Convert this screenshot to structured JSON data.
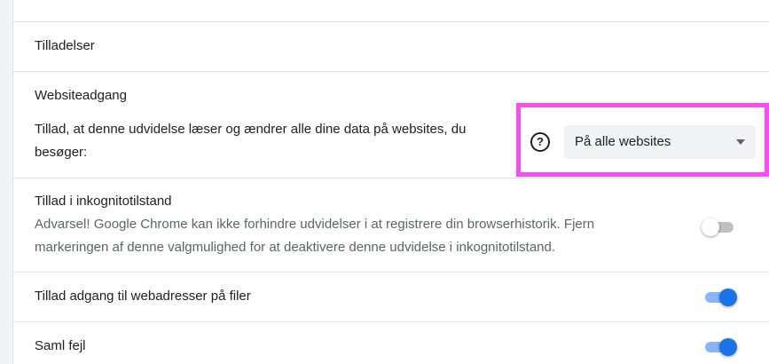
{
  "permissions": {
    "heading": "Tilladelser"
  },
  "site_access": {
    "heading": "Websiteadgang",
    "description_line1": "Tillad, at denne udvidelse læser og ændrer alle dine data på websites, du",
    "description_line2": "besøger:",
    "help_icon": "question-circle-icon",
    "dropdown_value": "På alle websites"
  },
  "incognito": {
    "title": "Tillad i inkognitotilstand",
    "warning_line1": "Advarsel! Google Chrome kan ikke forhindre udvidelser i at registrere din browserhistorik. Fjern",
    "warning_line2": "markeringen af denne valgmulighed for at deaktivere denne udvidelse i inkognitotilstand.",
    "enabled": false
  },
  "file_urls": {
    "title": "Tillad adgang til webadresser på filer",
    "enabled": true
  },
  "collect_errors": {
    "title": "Saml fejl",
    "enabled": true
  },
  "colors": {
    "accent": "#1a73e8",
    "highlight": "#f54ef0"
  }
}
